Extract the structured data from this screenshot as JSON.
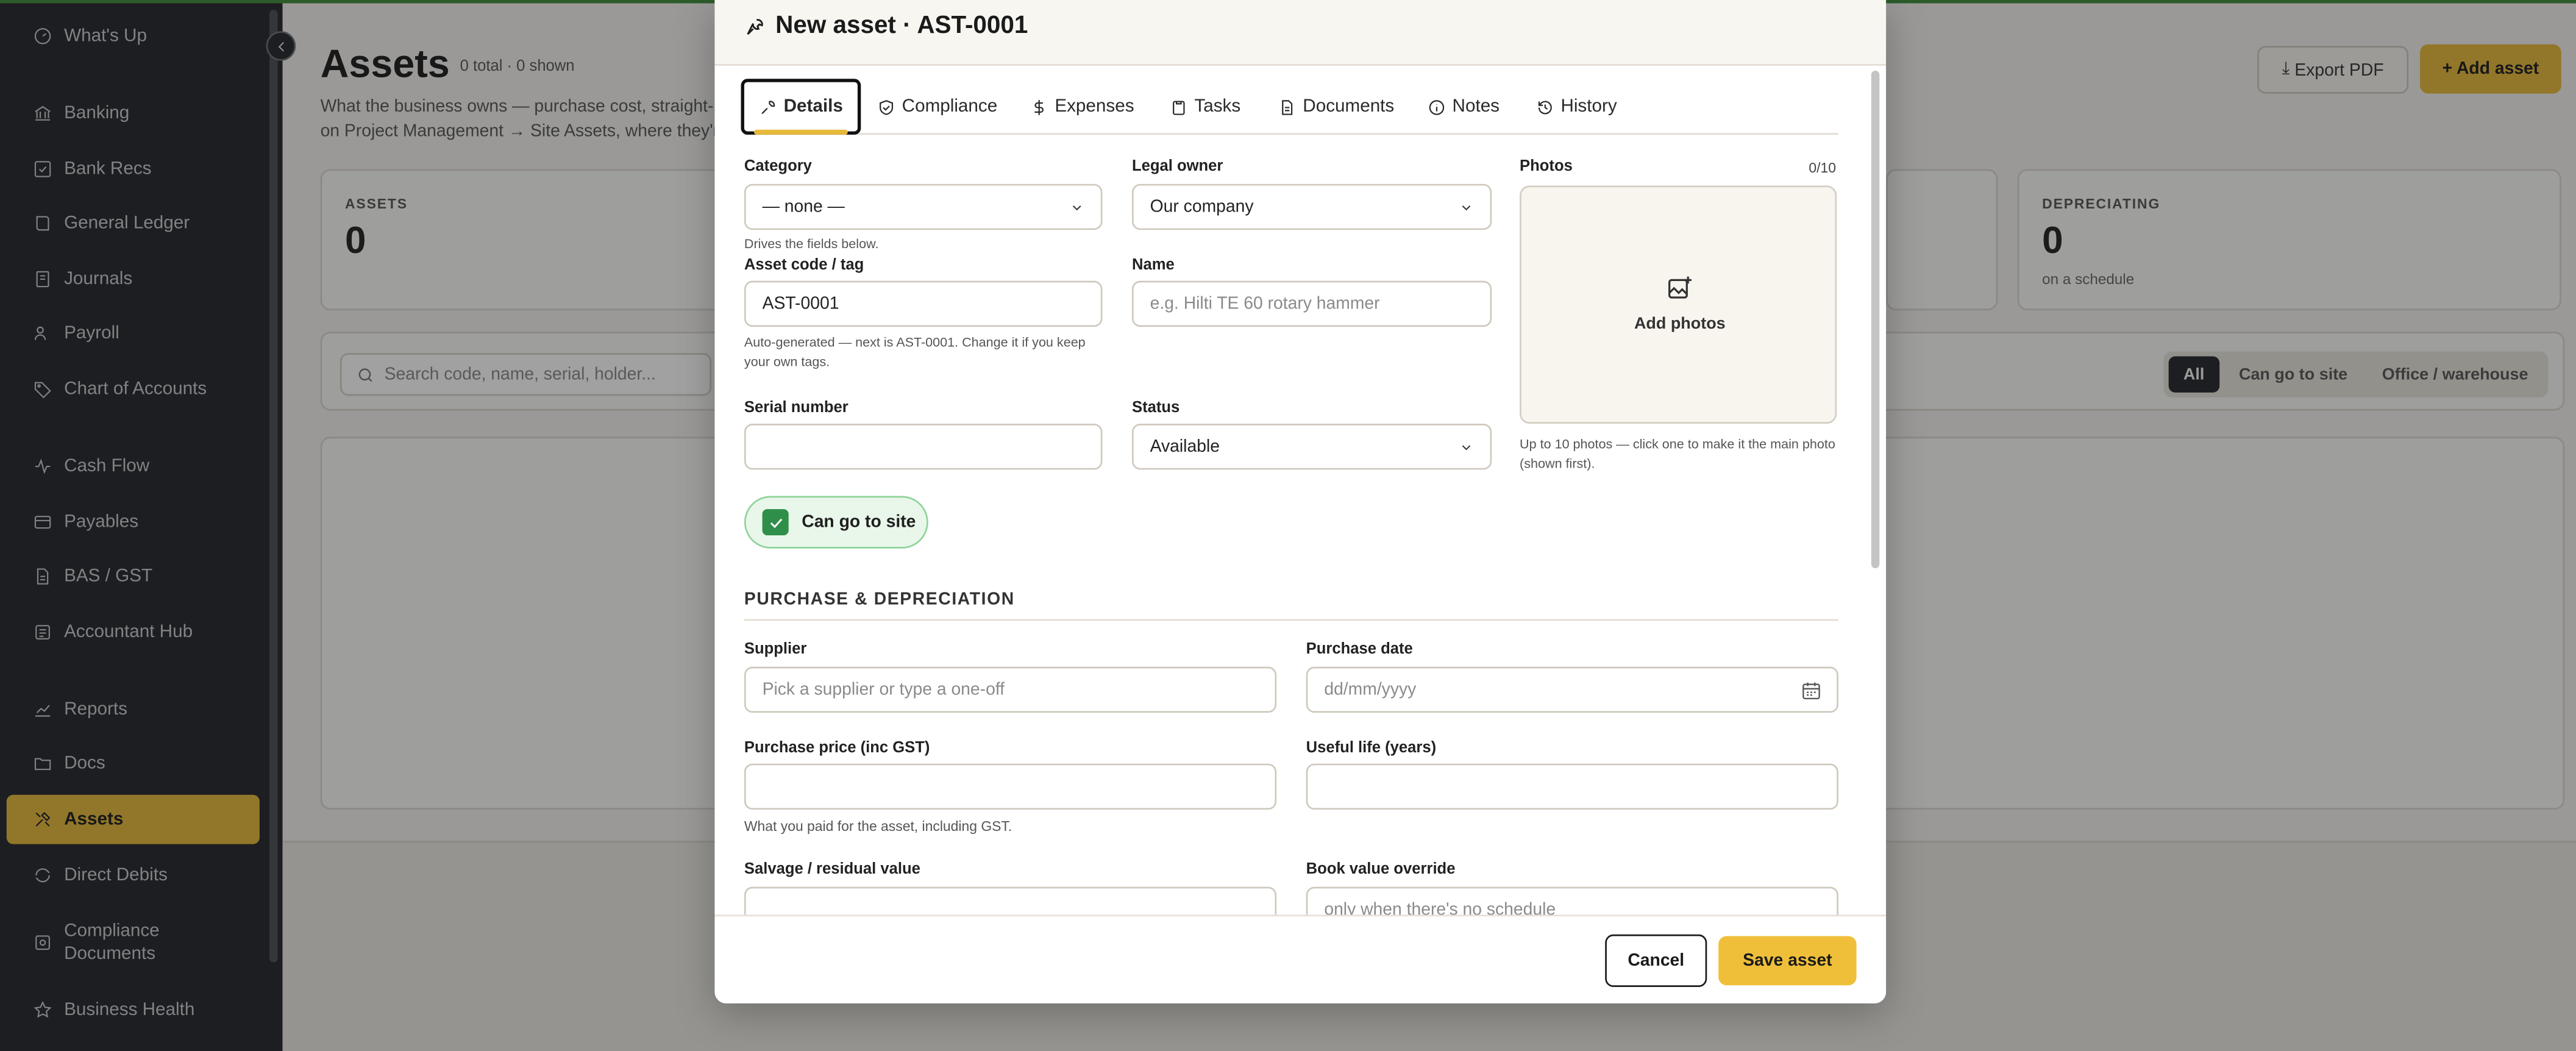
{
  "sidebar": {
    "items": [
      {
        "label": "What's Up",
        "icon": "gauge-icon"
      },
      {
        "label": "Banking",
        "icon": "bank-icon"
      },
      {
        "label": "Bank Recs",
        "icon": "check-square-icon"
      },
      {
        "label": "General Ledger",
        "icon": "book-icon"
      },
      {
        "label": "Journals",
        "icon": "journal-icon"
      },
      {
        "label": "Payroll",
        "icon": "users-icon"
      },
      {
        "label": "Chart of Accounts",
        "icon": "tag-icon"
      },
      {
        "label": "Cash Flow",
        "icon": "activity-icon"
      },
      {
        "label": "Payables",
        "icon": "receipt-icon"
      },
      {
        "label": "BAS / GST",
        "icon": "file-icon"
      },
      {
        "label": "Accountant Hub",
        "icon": "briefcase-icon"
      },
      {
        "label": "Reports",
        "icon": "chart-line-icon"
      },
      {
        "label": "Docs",
        "icon": "folder-icon"
      },
      {
        "label": "Assets",
        "icon": "tools-icon"
      },
      {
        "label": "Direct Debits",
        "icon": "repeat-icon"
      },
      {
        "label": "Compliance Documents",
        "icon": "file-check-icon"
      },
      {
        "label": "Business Health",
        "icon": "star-icon"
      }
    ],
    "active": "Assets"
  },
  "page": {
    "title": "Assets",
    "count": "0 total · 0 shown",
    "description": "What the business owns — purchase cost, straight-li… on Project Management → Site Assets, where they're…",
    "export_label": "Export PDF",
    "add_label": "+ Add asset"
  },
  "stats": [
    {
      "label": "ASSETS",
      "value": "0",
      "sub": ""
    },
    {
      "label": "DEPRECIATING",
      "value": "0",
      "sub": "on a schedule"
    }
  ],
  "filters": {
    "search_placeholder": "Search code, name, serial, holder...",
    "segments": [
      "All",
      "Can go to site",
      "Office / warehouse"
    ],
    "active_segment": "All"
  },
  "modal": {
    "title": "New asset · AST-0001",
    "tabs": [
      {
        "label": "Details",
        "icon": "wrench-icon"
      },
      {
        "label": "Compliance",
        "icon": "shield-check-icon"
      },
      {
        "label": "Expenses",
        "icon": "dollar-icon"
      },
      {
        "label": "Tasks",
        "icon": "clipboard-icon"
      },
      {
        "label": "Documents",
        "icon": "document-icon"
      },
      {
        "label": "Notes",
        "icon": "info-icon"
      },
      {
        "label": "History",
        "icon": "history-icon"
      }
    ],
    "active_tab": "Details",
    "fields": {
      "category": {
        "label": "Category",
        "value": "— none —",
        "hint": "Drives the fields below."
      },
      "legal_owner": {
        "label": "Legal owner",
        "value": "Our company"
      },
      "asset_code": {
        "label": "Asset code / tag",
        "value": "AST-0001",
        "hint": "Auto-generated — next is AST-0001. Change it if you keep your own tags."
      },
      "name": {
        "label": "Name",
        "placeholder": "e.g. Hilti TE 60 rotary hammer"
      },
      "serial": {
        "label": "Serial number",
        "value": ""
      },
      "status": {
        "label": "Status",
        "value": "Available"
      },
      "can_go_to_site": {
        "label": "Can go to site",
        "checked": true
      }
    },
    "photos": {
      "label": "Photos",
      "count": "0/10",
      "add_label": "Add photos",
      "hint": "Up to 10 photos — click one to make it the main photo (shown first)."
    },
    "purchase_section": {
      "title": "PURCHASE & DEPRECIATION",
      "supplier": {
        "label": "Supplier",
        "placeholder": "Pick a supplier or type a one-off"
      },
      "purchase_date": {
        "label": "Purchase date",
        "placeholder": "dd/mm/yyyy"
      },
      "purchase_price": {
        "label": "Purchase price (inc GST)",
        "value": "",
        "hint": "What you paid for the asset, including GST."
      },
      "useful_life": {
        "label": "Useful life (years)",
        "value": ""
      },
      "salvage": {
        "label": "Salvage / residual value",
        "value": ""
      },
      "book_value_override": {
        "label": "Book value override",
        "placeholder": "only when there's no schedule"
      }
    },
    "footer": {
      "cancel_label": "Cancel",
      "save_label": "Save asset"
    }
  },
  "colors": {
    "accent": "#e6b93a",
    "sidebar_bg": "#23262b",
    "success": "#2f8f4a"
  }
}
